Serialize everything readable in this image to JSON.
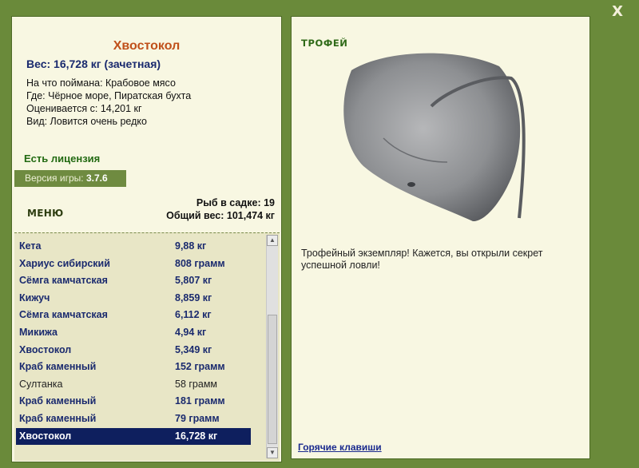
{
  "close": {
    "label": "X"
  },
  "details": {
    "fish_name": "Хвостокол",
    "weight": "Вес: 16,728 кг (зачетная)",
    "info": [
      "На что поймана: Крабовое мясо",
      "Где: Чёрное море, Пиратская бухта",
      "Оценивается с: 14,201 кг",
      "Вид: Ловится очень редко"
    ],
    "license": "Есть лицензия",
    "version_label": "Версия игры:",
    "version_value": "3.7.6"
  },
  "menu": {
    "label": "МЕНЮ"
  },
  "net": {
    "count": "Рыб в садке: 19",
    "total": "Общий вес: 101,474 кг"
  },
  "catch_list": [
    {
      "name": "Кета",
      "weight": "9,88 кг"
    },
    {
      "name": "Хариус сибирский",
      "weight": "808 грамм"
    },
    {
      "name": "Сёмга камчатская",
      "weight": "5,807 кг"
    },
    {
      "name": "Кижуч",
      "weight": "8,859 кг"
    },
    {
      "name": "Сёмга камчатская",
      "weight": "6,112 кг"
    },
    {
      "name": "Микижа",
      "weight": "4,94 кг"
    },
    {
      "name": "Хвостокол",
      "weight": "5,349 кг"
    },
    {
      "name": "Краб каменный",
      "weight": "152 грамм"
    },
    {
      "name": "Султанка",
      "weight": "58 грамм",
      "style": "plain"
    },
    {
      "name": "Краб каменный",
      "weight": "181 грамм"
    },
    {
      "name": "Краб каменный",
      "weight": "79 грамм"
    },
    {
      "name": "Хвостокол",
      "weight": "16,728 кг",
      "selected": true
    }
  ],
  "trophy": {
    "label": "ТРОФЕЙ",
    "text": "Трофейный экземпляр! Кажется, вы открыли секрет успешной ловли!"
  },
  "hotkeys": {
    "label": "Горячие клавиши"
  },
  "colors": {
    "frame": "#6a8a3a",
    "panel": "#f8f7e2",
    "fish_name": "#c0501a",
    "text_blue": "#1a2a6e",
    "license_green": "#226a12",
    "selected_row": "#0e1f5e"
  }
}
